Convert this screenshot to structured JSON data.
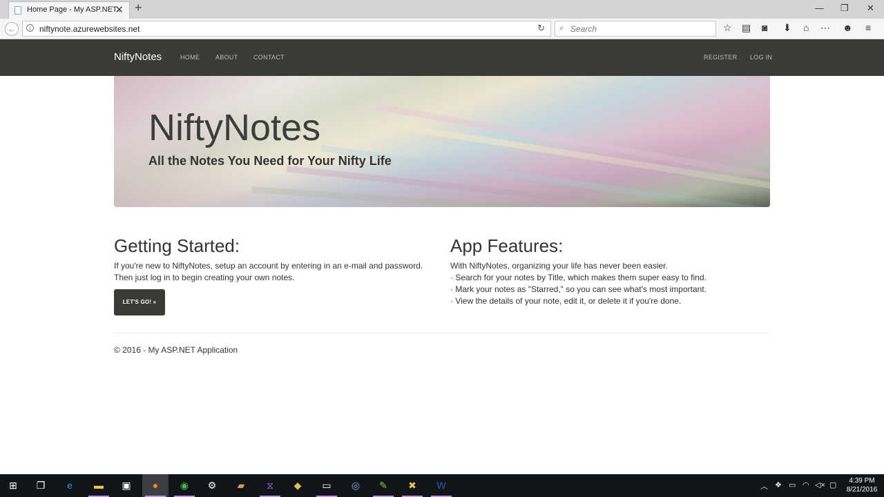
{
  "browser": {
    "tab_title": "Home Page - My ASP.NET...",
    "tab_close": "✕",
    "new_tab": "+",
    "url": "niftynote.azurewebsites.net",
    "search_placeholder": "Search",
    "win_minimize": "—",
    "win_restore": "❐",
    "win_close": "✕"
  },
  "site": {
    "brand": "NiftyNotes",
    "nav": [
      "HOME",
      "ABOUT",
      "CONTACT"
    ],
    "nav_right": [
      "REGISTER",
      "LOG IN"
    ]
  },
  "hero": {
    "title": "NiftyNotes",
    "subtitle": "All the Notes You Need for Your Nifty Life"
  },
  "getting_started": {
    "heading": "Getting Started:",
    "text_lines": [
      "If you're new to NiftyNotes, setup an account by entering in an e-mail and password.",
      "Then just log in to begin creating your own notes."
    ],
    "button": "LET'S GO! »"
  },
  "features": {
    "heading": "App Features:",
    "lines": [
      "With NiftyNotes, organizing your life has never been easier.",
      "· Search for your notes by Title, which makes them super easy to find.",
      "· Mark your notes as \"Starred,\" so you can see what's most important.",
      "· View the details of your note, edit it, or delete it if you're done."
    ]
  },
  "footer": "© 2016 - My ASP.NET Application",
  "taskbar": {
    "time": "4:39 PM",
    "date": "8/21/2016"
  },
  "colors": {
    "navbar": "#3a3a37",
    "button": "#3a3a37",
    "taskbar": "#111418",
    "text": "#333333"
  }
}
